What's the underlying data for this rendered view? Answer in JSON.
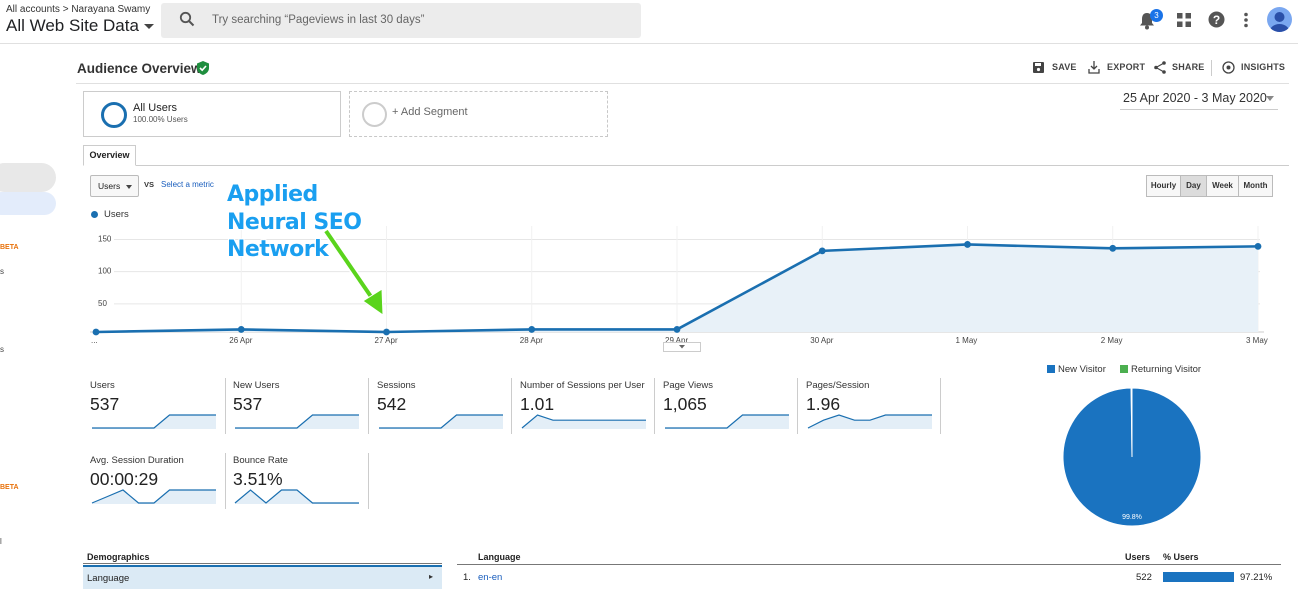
{
  "topbar": {
    "breadcrumb_root": "All accounts",
    "breadcrumb_sep": ">",
    "breadcrumb_account": "Narayana Swamy",
    "property": "All Web Site Data",
    "search_placeholder": "Try searching “Pageviews in last 30 days”",
    "notifications_count": "3"
  },
  "header": {
    "title": "Audience Overview",
    "actions": {
      "save": "SAVE",
      "export": "EXPORT",
      "share": "SHARE",
      "insights": "INSIGHTS"
    }
  },
  "segments": {
    "active": {
      "name": "All Users",
      "sub": "100.00% Users"
    },
    "add": "+ Add Segment"
  },
  "date_range": "25 Apr 2020 - 3 May 2020",
  "tabs": {
    "overview": "Overview"
  },
  "chart_controls": {
    "metric": "Users",
    "vs": "VS",
    "select_metric": "Select a metric",
    "granularity": [
      "Hourly",
      "Day",
      "Week",
      "Month"
    ],
    "active_granularity": "Day"
  },
  "annotation": {
    "line1": "Applied",
    "line2": "Neural SEO",
    "line3": "Network"
  },
  "leftnav": {
    "beta1": "BETA",
    "beta2": "BETA",
    "t1": "s",
    "t2": "s",
    "t3": "l"
  },
  "chart_data": {
    "type": "area",
    "legend": "Users",
    "x_ticks": [
      "...",
      "26 Apr",
      "27 Apr",
      "28 Apr",
      "29 Apr",
      "30 Apr",
      "1 May",
      "2 May",
      "3 May"
    ],
    "y_ticks": [
      "150",
      "100",
      "50"
    ],
    "ylim": [
      0,
      160
    ],
    "series": [
      {
        "name": "Users",
        "values": [
          0,
          4,
          0,
          4,
          4,
          126,
          136,
          130,
          133
        ],
        "color": "#1a6fb0"
      }
    ]
  },
  "stats": [
    {
      "label": "Users",
      "value": "537",
      "spark": [
        0,
        0,
        0,
        0,
        0,
        1,
        1,
        1,
        1
      ]
    },
    {
      "label": "New Users",
      "value": "537",
      "spark": [
        0,
        0,
        0,
        0,
        0,
        1,
        1,
        1,
        1
      ]
    },
    {
      "label": "Sessions",
      "value": "542",
      "spark": [
        0,
        0,
        0,
        0,
        0,
        1,
        1,
        1,
        1
      ]
    },
    {
      "label": "Number of Sessions per User",
      "value": "1.01",
      "spark": [
        0,
        1,
        0.6,
        0.6,
        0.6,
        0.6,
        0.6,
        0.6,
        0.6
      ]
    },
    {
      "label": "Page Views",
      "value": "1,065",
      "spark": [
        0,
        0,
        0,
        0,
        0,
        1,
        1,
        1,
        1
      ]
    },
    {
      "label": "Pages/Session",
      "value": "1.96",
      "spark": [
        0,
        0.6,
        1,
        0.6,
        0.6,
        1,
        1,
        1,
        1
      ]
    },
    {
      "label": "Avg. Session Duration",
      "value": "00:00:29",
      "spark": [
        0,
        0.5,
        1,
        0,
        0,
        1,
        1,
        1,
        1
      ]
    },
    {
      "label": "Bounce Rate",
      "value": "3.51%",
      "spark": [
        0,
        1,
        0,
        1,
        1,
        0,
        0,
        0,
        0
      ]
    }
  ],
  "pie": {
    "legend": [
      {
        "label": "New Visitor",
        "color": "#1a73c0"
      },
      {
        "label": "Returning Visitor",
        "color": "#4caf50"
      }
    ],
    "slice_label": "99.8%",
    "values": [
      99.8,
      0.2
    ]
  },
  "demographics": {
    "title": "Demographics",
    "row": "Language"
  },
  "language_table": {
    "title": "Language",
    "col_users": "Users",
    "col_pct": "% Users",
    "rows": [
      {
        "rank": "1.",
        "lang": "en-en",
        "users": "522",
        "pct": "97.21%"
      }
    ]
  }
}
